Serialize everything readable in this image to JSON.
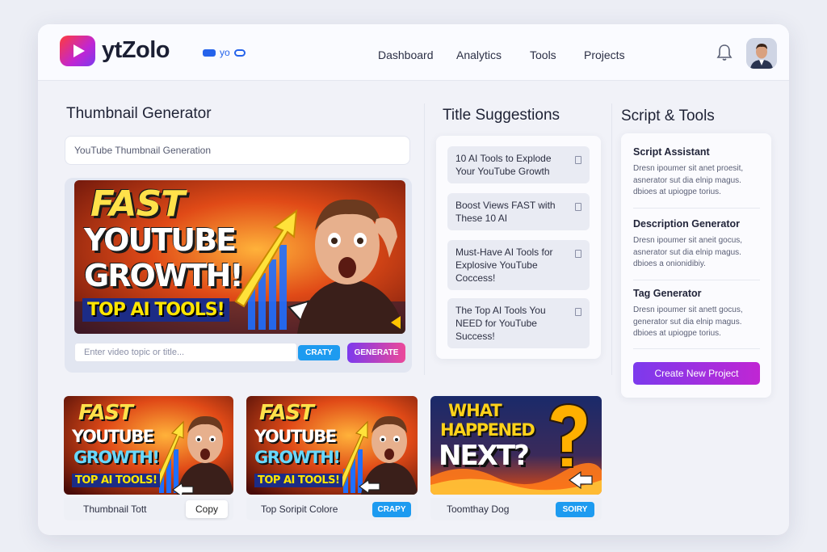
{
  "app": {
    "brand": "ytZolo",
    "badge_text": "yo"
  },
  "nav": [
    "Dashboard",
    "Analytics",
    "Tools",
    "Projects"
  ],
  "thumbnail_generator": {
    "title": "Thumbnail Generator",
    "topic_value": "YouTube Thumbnail Generation",
    "hero": {
      "line1": "FAST",
      "line2": "YOUTUBE",
      "line3": "GROWTH!",
      "line4": "TOP AI TOOLS!"
    },
    "input_placeholder": "Enter video topic or title...",
    "craft_label": "CRATY",
    "generate_label": "GENERATE"
  },
  "title_suggestions": {
    "title": "Title Suggestions",
    "items": [
      "10 AI Tools to Explode Your YouTube Growth",
      "Boost Views FAST with These 10 AI",
      "Must-Have AI Tools for Explosive YouTube Coccess!",
      "The Top AI Tools You NEED for YouTube Success!"
    ]
  },
  "script_tools": {
    "title": "Script & Tools",
    "tools": [
      {
        "name": "Script Assistant",
        "desc": [
          "Dresn ipoumer sit anet proesit,",
          "asnerator sut dia elnip magus.",
          "dbioes at upiogpe torius."
        ]
      },
      {
        "name": "Description Generator",
        "desc": [
          "Dresn ipoumer sit aneit gocus,",
          "asnerator sut dia elnip magus.",
          "dbioes a onionidibiy."
        ]
      },
      {
        "name": "Tag Generator",
        "desc": [
          "Dresn ipoumer sit anett gocus,",
          "generator sut dia elnip magus.",
          "dbioes at upiogpe torius."
        ]
      }
    ],
    "create_label": "Create New Project"
  },
  "gallery": [
    {
      "label": "Thumbnail Tott",
      "button": "Copy",
      "art": {
        "l1": "FAST",
        "l2": "YOUTUBE",
        "l3": "GROWTH!",
        "l4": "TOP AI TOOLS!"
      }
    },
    {
      "label": "Top Soripit Colore",
      "button": "CRAPY",
      "art": {
        "l1": "FAST",
        "l2": "YOUTUBE",
        "l3": "GROWTH!",
        "l4": "TOP AI TOOLS!"
      }
    },
    {
      "label": "Toomthay Dog",
      "button": "SOIRY",
      "art": {
        "l1": "WHAT",
        "l2": "HAPPENED",
        "l3": "NEXT?",
        "l4": ""
      }
    }
  ],
  "colors": {
    "accent_blue": "#1d9bf0",
    "accent_purple": "#7c3aed",
    "accent_pink": "#ec4899"
  }
}
